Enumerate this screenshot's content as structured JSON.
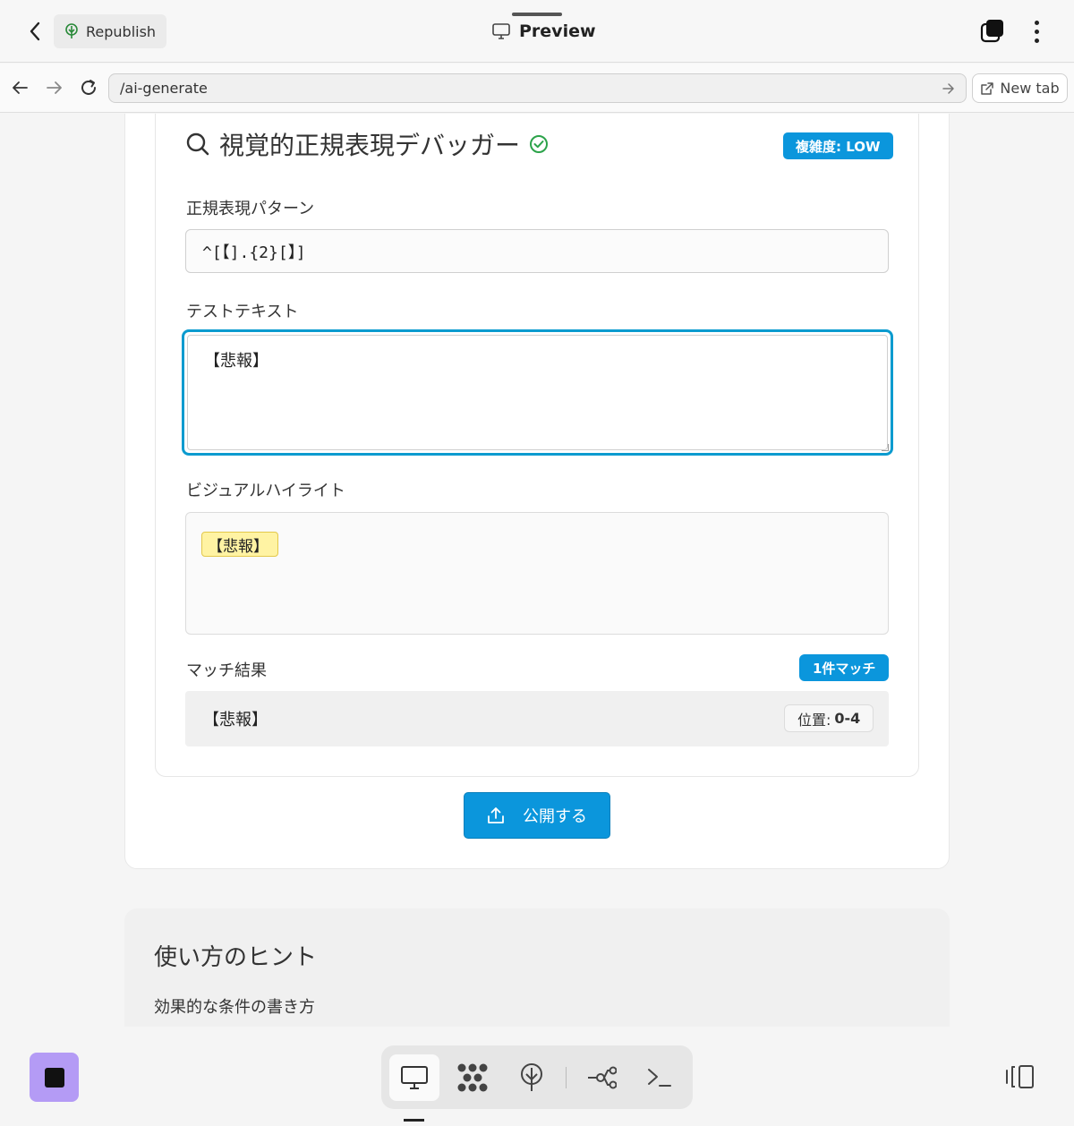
{
  "topbar": {
    "republish_label": "Republish",
    "preview_label": "Preview"
  },
  "navbar": {
    "url": "/ai-generate",
    "new_tab_label": "New tab"
  },
  "tool": {
    "title": "視覚的正規表現デバッガー",
    "complexity_badge": "複雑度: LOW",
    "pattern_label": "正規表現パターン",
    "pattern_value": "^[【].{2}[】]",
    "test_label": "テストテキスト",
    "test_value": "【悲報】",
    "highlight_label": "ビジュアルハイライト",
    "highlight_match": "【悲報】",
    "results_label": "マッチ結果",
    "match_count": "1件マッチ",
    "results": [
      {
        "text": "【悲報】",
        "position_label": "位置:",
        "position_value": "0-4"
      }
    ],
    "publish_label": "公開する"
  },
  "hints": {
    "title": "使い方のヒント",
    "subtitle": "効果的な条件の書き方"
  },
  "colors": {
    "accent": "#0b96dc",
    "focus_ring": "#0b9bcf",
    "highlight_fill": "#fff3a3",
    "success": "#2ca34a",
    "stop_button": "#b49bf5"
  },
  "icons": {
    "back": "chevron-left-icon",
    "republish": "tree-icon",
    "preview": "monitor-icon",
    "tabs": "tabs-icon",
    "menu": "kebab-icon",
    "title": "search-icon",
    "verified": "check-circle-icon",
    "publish": "upload-icon"
  }
}
